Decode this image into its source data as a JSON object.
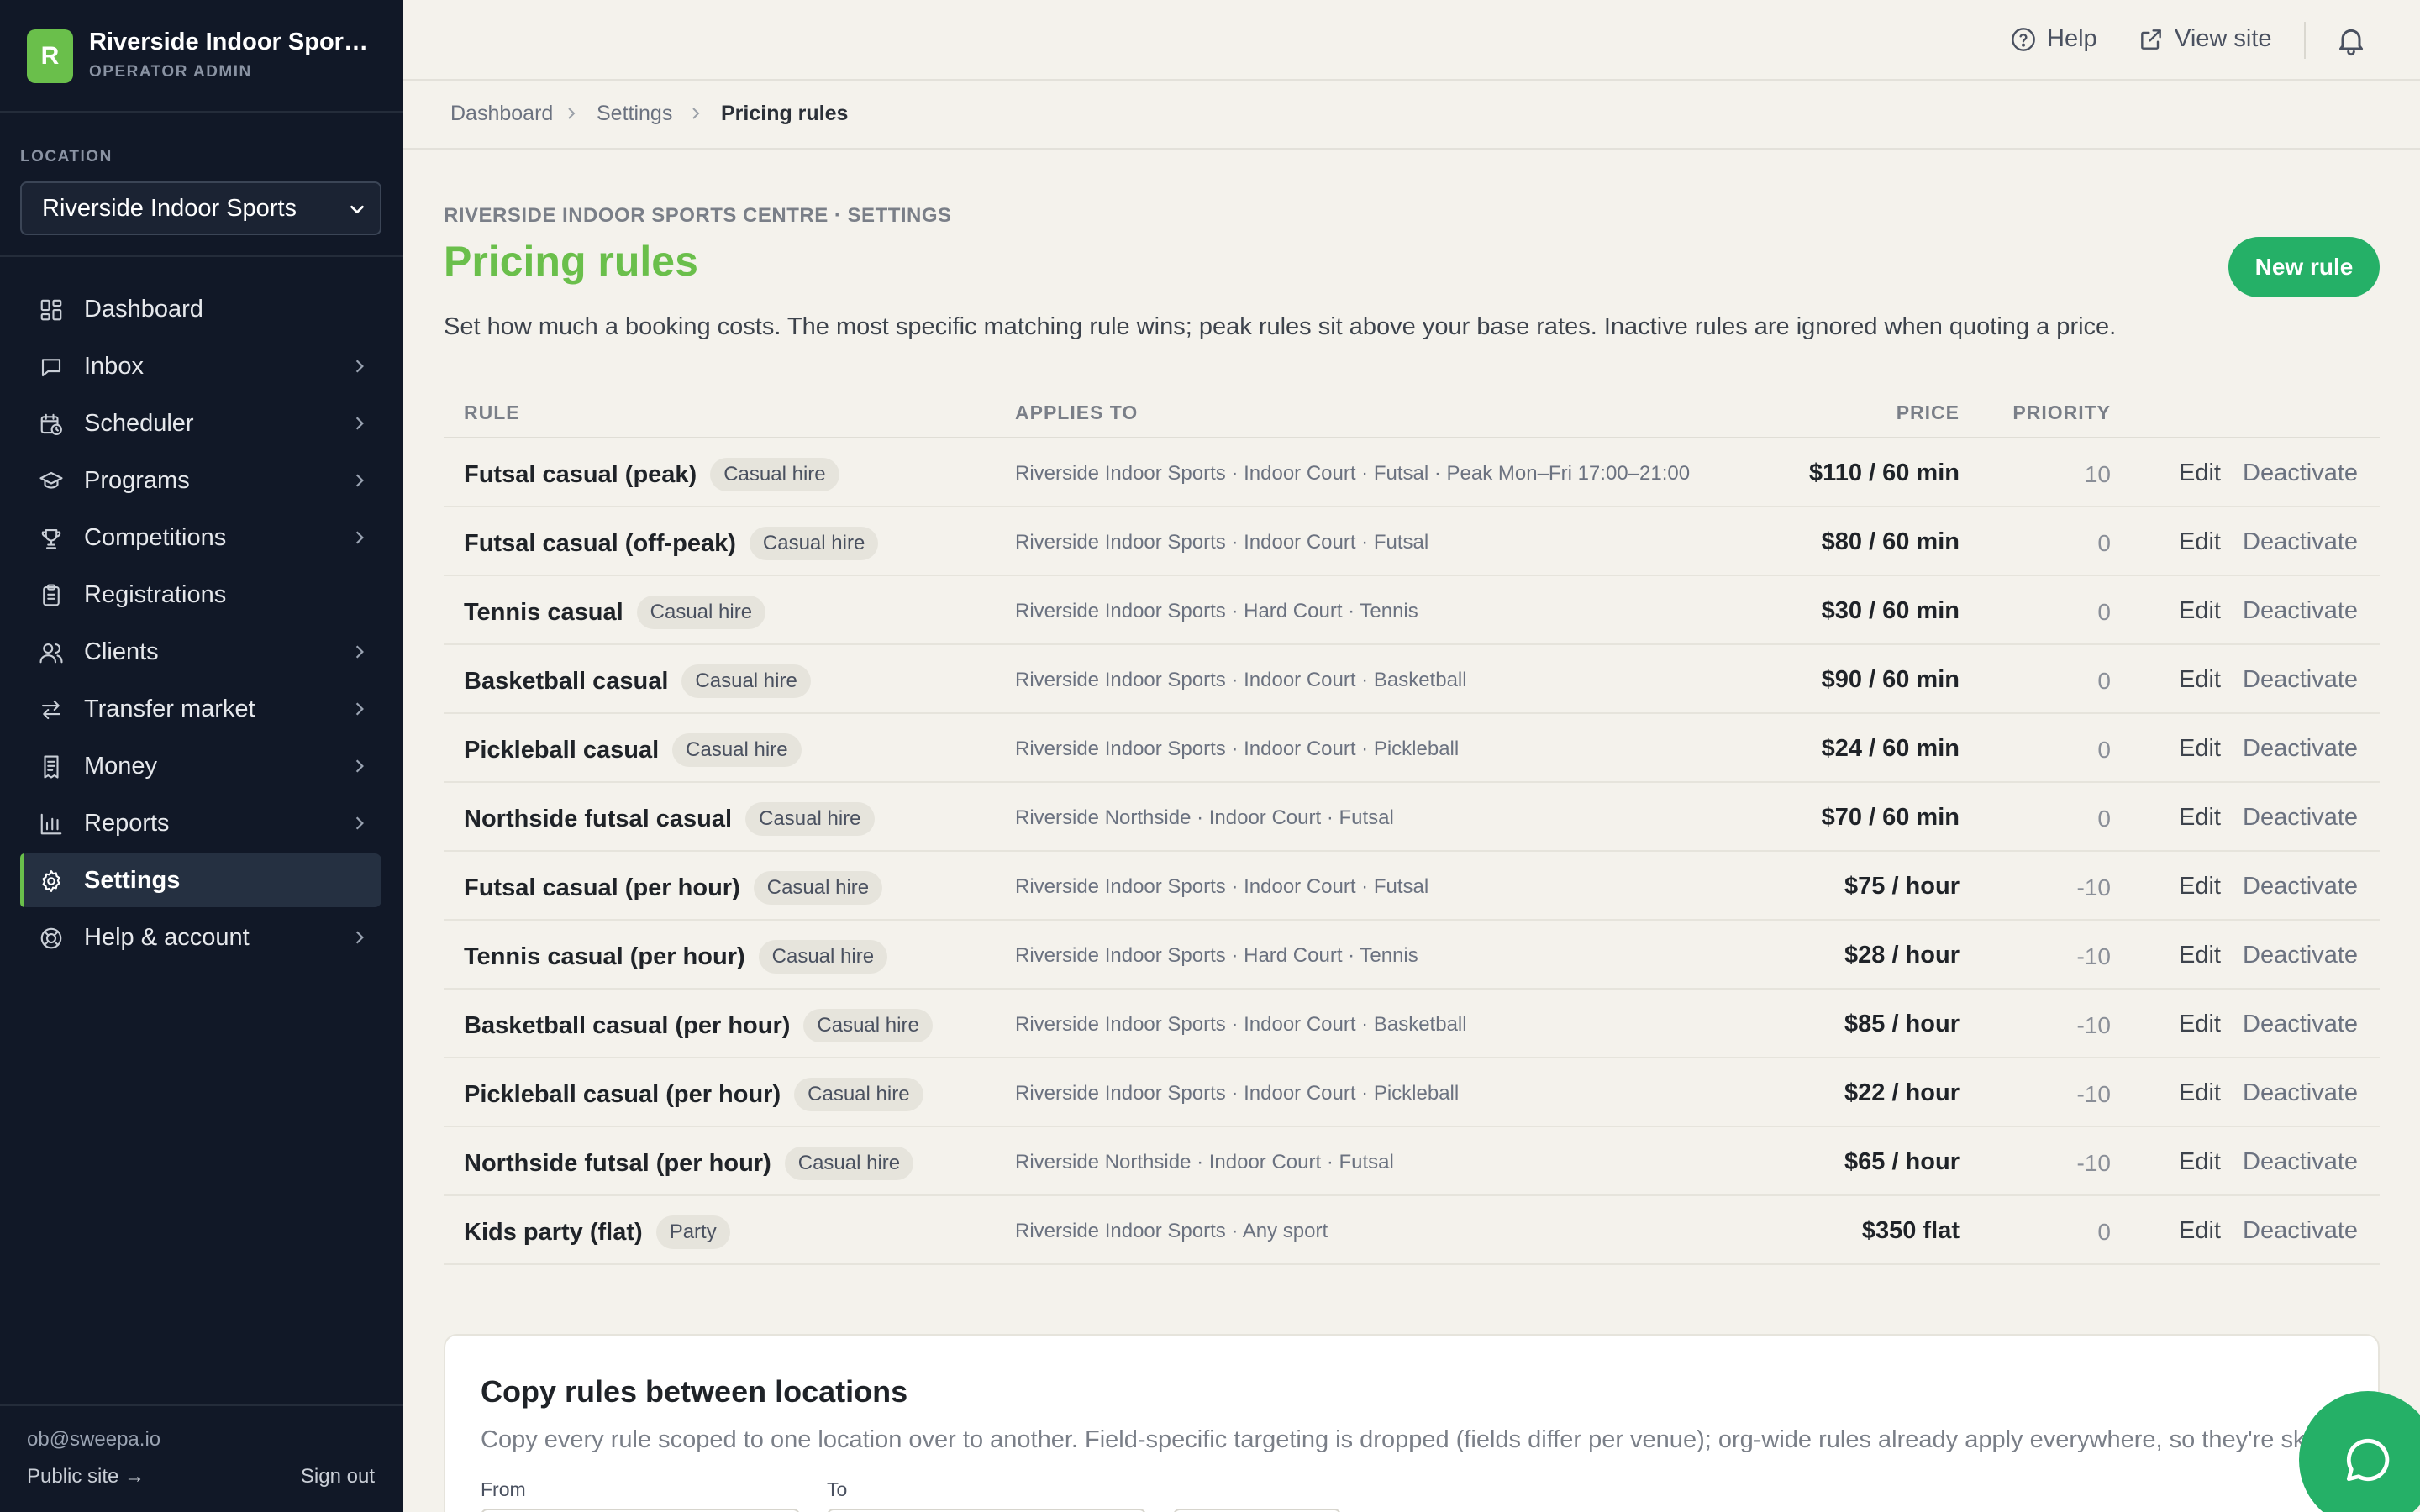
{
  "colors": {
    "sidebar_bg": "#111827",
    "brand_green": "#6abf4b",
    "primary_button": "#25b067",
    "page_bg": "#f4f2ec"
  },
  "sidebar": {
    "brand_initial": "R",
    "brand_name": "Riverside Indoor Sports Centre",
    "brand_role": "OPERATOR ADMIN",
    "location_label": "LOCATION",
    "location_value": "Riverside Indoor Sports",
    "items": [
      {
        "label": "Dashboard",
        "icon": "dashboard-icon",
        "chevron": false,
        "active": false
      },
      {
        "label": "Inbox",
        "icon": "inbox-icon",
        "chevron": true,
        "active": false
      },
      {
        "label": "Scheduler",
        "icon": "calendar-clock-icon",
        "chevron": true,
        "active": false
      },
      {
        "label": "Programs",
        "icon": "graduation-cap-icon",
        "chevron": true,
        "active": false
      },
      {
        "label": "Competitions",
        "icon": "trophy-icon",
        "chevron": true,
        "active": false
      },
      {
        "label": "Registrations",
        "icon": "clipboard-icon",
        "chevron": false,
        "active": false
      },
      {
        "label": "Clients",
        "icon": "users-icon",
        "chevron": true,
        "active": false
      },
      {
        "label": "Transfer market",
        "icon": "swap-arrows-icon",
        "chevron": true,
        "active": false
      },
      {
        "label": "Money",
        "icon": "receipt-icon",
        "chevron": true,
        "active": false
      },
      {
        "label": "Reports",
        "icon": "bar-chart-icon",
        "chevron": true,
        "active": false
      },
      {
        "label": "Settings",
        "icon": "gear-icon",
        "chevron": false,
        "active": true
      },
      {
        "label": "Help & account",
        "icon": "lifebuoy-icon",
        "chevron": true,
        "active": false
      }
    ],
    "footer_email": "ob@sweepa.io",
    "footer_public": "Public site →",
    "footer_signout": "Sign out"
  },
  "topbar": {
    "help": "Help",
    "view_site": "View site"
  },
  "breadcrumb": [
    "Dashboard",
    "Settings",
    "Pricing rules"
  ],
  "header": {
    "eyebrow": "RIVERSIDE INDOOR SPORTS CENTRE · SETTINGS",
    "title": "Pricing rules",
    "new_rule": "New rule",
    "description": "Set how much a booking costs. The most specific matching rule wins; peak rules sit above your base rates. Inactive rules are ignored when quoting a price."
  },
  "table": {
    "columns": {
      "rule": "RULE",
      "applies": "APPLIES TO",
      "price": "PRICE",
      "priority": "PRIORITY"
    },
    "edit_label": "Edit",
    "deactivate_label": "Deactivate",
    "rows": [
      {
        "name": "Futsal casual (peak)",
        "tag": "Casual hire",
        "applies": "Riverside Indoor Sports · Indoor Court · Futsal · Peak Mon–Fri 17:00–21:00",
        "price": "$110 / 60 min",
        "priority": "10"
      },
      {
        "name": "Futsal casual (off-peak)",
        "tag": "Casual hire",
        "applies": "Riverside Indoor Sports · Indoor Court · Futsal",
        "price": "$80 / 60 min",
        "priority": "0"
      },
      {
        "name": "Tennis casual",
        "tag": "Casual hire",
        "applies": "Riverside Indoor Sports · Hard Court · Tennis",
        "price": "$30 / 60 min",
        "priority": "0"
      },
      {
        "name": "Basketball casual",
        "tag": "Casual hire",
        "applies": "Riverside Indoor Sports · Indoor Court · Basketball",
        "price": "$90 / 60 min",
        "priority": "0"
      },
      {
        "name": "Pickleball casual",
        "tag": "Casual hire",
        "applies": "Riverside Indoor Sports · Indoor Court · Pickleball",
        "price": "$24 / 60 min",
        "priority": "0"
      },
      {
        "name": "Northside futsal casual",
        "tag": "Casual hire",
        "applies": "Riverside Northside · Indoor Court · Futsal",
        "price": "$70 / 60 min",
        "priority": "0"
      },
      {
        "name": "Futsal casual (per hour)",
        "tag": "Casual hire",
        "applies": "Riverside Indoor Sports · Indoor Court · Futsal",
        "price": "$75 / hour",
        "priority": "-10"
      },
      {
        "name": "Tennis casual (per hour)",
        "tag": "Casual hire",
        "applies": "Riverside Indoor Sports · Hard Court · Tennis",
        "price": "$28 / hour",
        "priority": "-10"
      },
      {
        "name": "Basketball casual (per hour)",
        "tag": "Casual hire",
        "applies": "Riverside Indoor Sports · Indoor Court · Basketball",
        "price": "$85 / hour",
        "priority": "-10"
      },
      {
        "name": "Pickleball casual (per hour)",
        "tag": "Casual hire",
        "applies": "Riverside Indoor Sports · Indoor Court · Pickleball",
        "price": "$22 / hour",
        "priority": "-10"
      },
      {
        "name": "Northside futsal (per hour)",
        "tag": "Casual hire",
        "applies": "Riverside Northside · Indoor Court · Futsal",
        "price": "$65 / hour",
        "priority": "-10"
      },
      {
        "name": "Kids party (flat)",
        "tag": "Party",
        "applies": "Riverside Indoor Sports · Any sport",
        "price": "$350 flat",
        "priority": "0"
      }
    ]
  },
  "copy_card": {
    "title": "Copy rules between locations",
    "description": "Copy every rule scoped to one location over to another. Field-specific targeting is dropped (fields differ per venue); org-wide rules already apply everywhere, so they're skipped.",
    "from_label": "From",
    "to_label": "To"
  }
}
